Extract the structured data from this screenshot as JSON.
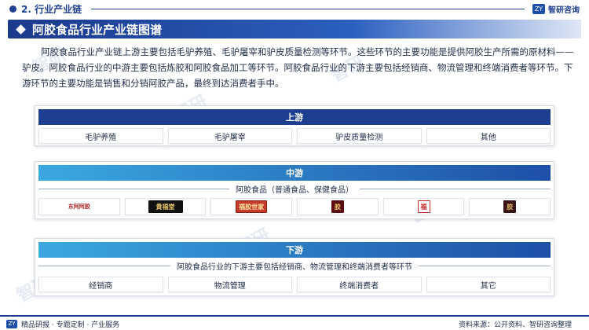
{
  "header": {
    "section_title": "2. 行业产业链",
    "brand": "智研咨询",
    "brand_mark": "ZY"
  },
  "title": "阿胶食品行业产业链图谱",
  "intro": "阿胶食品行业产业链上游主要包括毛驴养殖、毛驴屠宰和驴皮质量检测等环节。这些环节的主要功能是提供阿胶生产所需的原材料——驴皮。阿胶食品行业的中游主要包括炼胶和阿胶食品加工等环节。阿胶食品行业的下游主要包括经销商、物流管理和终端消费者等环节。下游环节的主要功能是销售和分销阿胶产品，最终到达消费者手中。",
  "upstream": {
    "label": "上游",
    "items": [
      "毛驴养殖",
      "毛驴屠宰",
      "驴皮质量检测",
      "其他"
    ]
  },
  "midstream": {
    "label": "中游",
    "subtitle": "阿胶食品（普通食品、保健食品）",
    "logos": [
      {
        "icon": "dong-e-ejiao-logo",
        "text": "东阿阿胶"
      },
      {
        "icon": "guifutang-logo",
        "text": "貴福堂"
      },
      {
        "icon": "fujiao-logo",
        "text": "福胶世家"
      },
      {
        "icon": "brand-logo-red",
        "text": "胶"
      },
      {
        "icon": "brand-logo-fu",
        "text": "福"
      },
      {
        "icon": "brand-logo-dark",
        "text": "胶"
      }
    ]
  },
  "downstream": {
    "label": "下游",
    "subtitle": "阿胶食品行业的下游主要包括经销商、物流管理和终端消费者等环节",
    "items": [
      "经销商",
      "物流管理",
      "终端消费者",
      "其它"
    ]
  },
  "footer": {
    "left_text": "精品研报 · 专题定制 · 产业服务",
    "source": "资料来源：公开资料、智研咨询整理"
  },
  "colors": {
    "primary": "#1e3f8f",
    "accent": "#2b5fc0",
    "light_blue": "#3aa9df"
  }
}
